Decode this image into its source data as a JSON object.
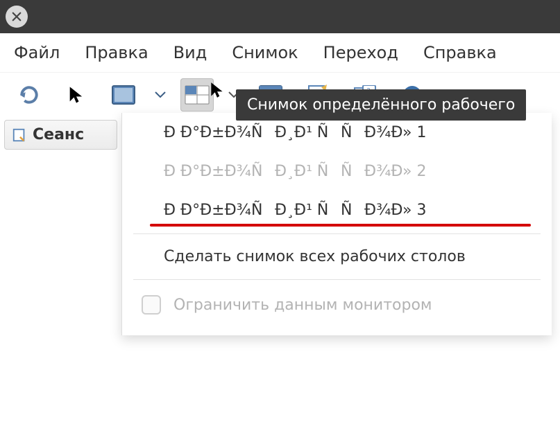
{
  "titlebar": {
    "close": "×"
  },
  "menubar": {
    "file": "Файл",
    "edit": "Правка",
    "view": "Вид",
    "screenshot": "Снимок",
    "go": "Переход",
    "help": "Справка"
  },
  "toolbar": {
    "tooltip": "Снимок определённого рабочего"
  },
  "sidebar": {
    "session": "Сеанс"
  },
  "dropdown": {
    "items": [
      {
        "label": "Ð Ð°Ð±Ð¾ÑÐ¸Ð¹ ÑÑÐ¾Ð» 1",
        "state": "normal"
      },
      {
        "label": "Ð Ð°Ð±Ð¾ÑÐ¸Ð¹ ÑÑÐ¾Ð» 2",
        "state": "disabled"
      },
      {
        "label": "Ð Ð°Ð±Ð¾ÑÐ¸Ð¹ ÑÑÐ¾Ð» 3",
        "state": "highlight"
      }
    ],
    "all_desktops": "Сделать снимок всех рабочих столов",
    "limit_monitor": "Ограничить данным монитором"
  }
}
